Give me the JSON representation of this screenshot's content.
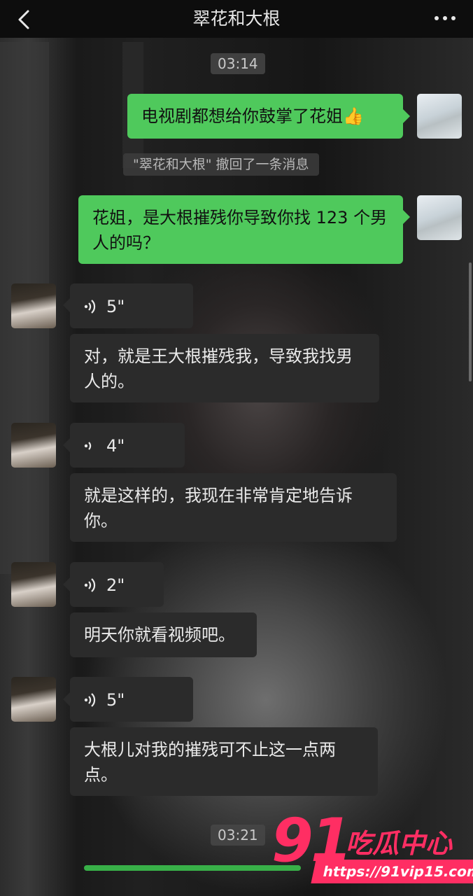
{
  "header": {
    "title": "翠花和大根"
  },
  "timestamps": [
    "03:14",
    "03:21"
  ],
  "system_notice": "\"翠花和大根\" 撤回了一条消息",
  "messages": [
    {
      "side": "out",
      "text": "电视剧都想给你鼓掌了花姐👍"
    },
    {
      "side": "out",
      "text": "花姐，是大根摧残你导致你找 123 个男人的吗？"
    },
    {
      "side": "in",
      "type": "voice",
      "duration": "5\""
    },
    {
      "side": "in",
      "text": "对，就是王大根摧残我，导致我找男人的。"
    },
    {
      "side": "in",
      "type": "voice",
      "duration": "4\""
    },
    {
      "side": "in",
      "text": "就是这样的，我现在非常肯定地告诉你。"
    },
    {
      "side": "in",
      "type": "voice",
      "duration": "2\""
    },
    {
      "side": "in",
      "text": "明天你就看视频吧。"
    },
    {
      "side": "in",
      "type": "voice",
      "duration": "5\""
    },
    {
      "side": "in",
      "text": "大根儿对我的摧残可不止这一点两点。"
    }
  ],
  "watermark": {
    "number": "91",
    "name": "吃瓜中心",
    "url": "https://91vip15.com"
  },
  "icons": {
    "back": "chevron-left-icon",
    "more": "more-dots-icon",
    "voice": "voice-wave-icon"
  },
  "colors": {
    "outgoing_bubble": "#4fc95c",
    "incoming_bubble": "#2b2b2b",
    "watermark": "#ff2e63"
  }
}
